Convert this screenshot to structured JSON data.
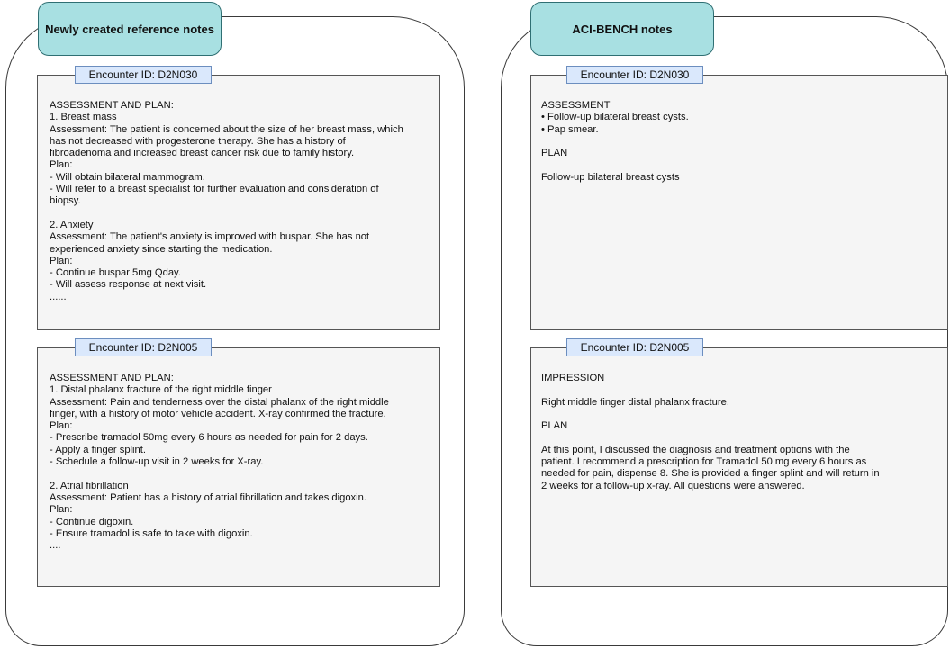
{
  "left": {
    "title": "Newly created reference notes",
    "cards": [
      {
        "encounter": "Encounter ID: D2N030",
        "lines": [
          "ASSESSMENT AND PLAN:",
          "1. Breast mass",
          "Assessment: The patient is concerned about the size of her breast mass, which",
          "has not decreased with progesterone therapy. She has a history of",
          "fibroadenoma and increased breast cancer risk due to family history.",
          "Plan:",
          "- Will obtain bilateral mammogram.",
          "- Will refer to a breast specialist for further evaluation and consideration of",
          "biopsy.",
          "",
          "2. Anxiety",
          "Assessment: The patient's anxiety is improved with buspar. She has not",
          "experienced anxiety since starting the medication.",
          "Plan:",
          "- Continue buspar 5mg Qday.",
          "- Will assess response at next visit.",
          "......"
        ]
      },
      {
        "encounter": "Encounter ID: D2N005",
        "lines": [
          "ASSESSMENT AND PLAN:",
          "1. Distal phalanx fracture of the right middle finger",
          "Assessment: Pain and tenderness over the distal phalanx of the right middle",
          "finger, with a history of motor vehicle accident. X-ray confirmed the fracture.",
          "Plan:",
          "- Prescribe tramadol 50mg every 6 hours as needed for pain for 2 days.",
          "- Apply a finger splint.",
          "- Schedule a follow-up visit in 2 weeks for X-ray.",
          "",
          "2. Atrial fibrillation",
          "Assessment: Patient has a history of atrial fibrillation and takes digoxin.",
          "Plan:",
          "- Continue digoxin.",
          "- Ensure tramadol is safe to take with digoxin.",
          "...."
        ]
      }
    ]
  },
  "right": {
    "title": "ACI-BENCH notes",
    "cards": [
      {
        "encounter": "Encounter ID: D2N030",
        "lines": [
          "ASSESSMENT",
          "• Follow-up bilateral breast cysts.",
          "• Pap smear.",
          "",
          "PLAN",
          "",
          "Follow-up bilateral breast cysts"
        ]
      },
      {
        "encounter": "Encounter ID: D2N005",
        "lines": [
          "IMPRESSION",
          "",
          "Right middle finger distal phalanx fracture.",
          "",
          "PLAN",
          "",
          "At this point, I discussed the diagnosis and treatment options with the",
          "patient. I recommend a prescription for Tramadol 50 mg every 6 hours as",
          "needed for pain, dispense 8. She is provided a finger splint and will return in",
          "2 weeks for a follow-up x-ray. All questions were answered."
        ]
      }
    ]
  }
}
